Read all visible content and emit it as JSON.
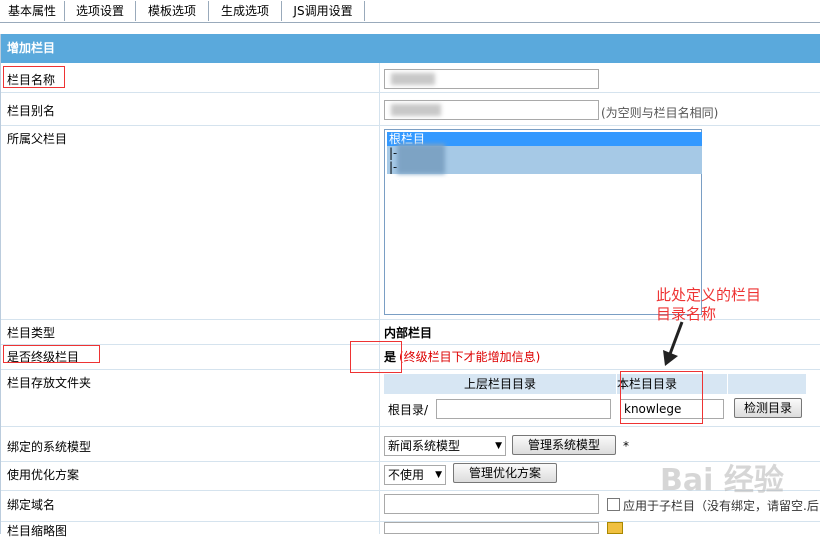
{
  "tabs": [
    "基本属性",
    "选项设置",
    "模板选项",
    "生成选项",
    "JS调用设置"
  ],
  "panel_title": "增加栏目",
  "fields": {
    "name_label": "栏目名称",
    "alias_label": "栏目别名",
    "alias_hint": "(为空则与栏目名相同)",
    "parent_label": "所属父栏目",
    "parent_options": [
      "根栏目",
      "|-",
      "|-"
    ],
    "type_label": "栏目类型",
    "type_value": "内部栏目",
    "final_label": "是否终级栏目",
    "final_value": "是",
    "final_hint": "(终级栏目下才能增加信息)",
    "folder_label": "栏目存放文件夹",
    "folder_header_parent": "上层栏目目录",
    "folder_header_self": "本栏目目录",
    "root_dir_label": "根目录/",
    "self_dir_value": "knowlege",
    "check_dir_button": "检测目录",
    "model_label": "绑定的系统模型",
    "model_value": "新闻系统模型",
    "manage_model_button": "管理系统模型",
    "required_mark": "*",
    "opt_label": "使用优化方案",
    "opt_value": "不使用",
    "manage_opt_button": "管理优化方案",
    "domain_label": "绑定域名",
    "domain_checkbox_label": "应用于子栏目（没有绑定，请留空.后",
    "thumb_label": "栏目缩略图"
  },
  "annotation": {
    "text_line1": "此处定义的栏目",
    "text_line2": "目录名称"
  },
  "watermark": "Bai 经验"
}
